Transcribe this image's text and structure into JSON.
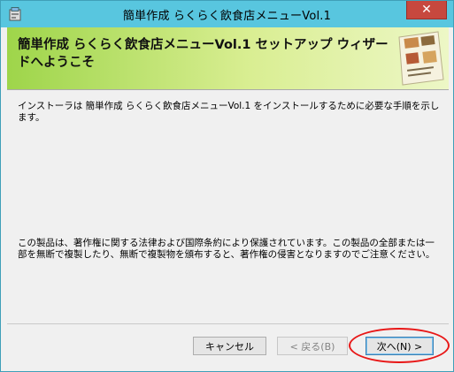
{
  "window": {
    "title": "簡単作成 らくらく飲食店メニューVol.1",
    "close_label": "✕"
  },
  "banner": {
    "title": "簡単作成 らくらく飲食店メニューVol.1 セットアップ ウィザードへようこそ"
  },
  "content": {
    "description": "インストーラは 簡単作成 らくらく飲食店メニューVol.1 をインストールするために必要な手順を示します。",
    "copyright": "この製品は、著作権に関する法律および国際条約により保護されています。この製品の全部または一部を無断で複製したり、無断で複製物を頒布すると、著作権の侵害となりますのでご注意ください。"
  },
  "buttons": {
    "cancel": "キャンセル",
    "back": "< 戻る(B)",
    "next": "次へ(N) >"
  },
  "colors": {
    "titlebar": "#58c6df",
    "close": "#c7483e",
    "banner_start": "#9ed54a",
    "annotation": "#e81717"
  }
}
